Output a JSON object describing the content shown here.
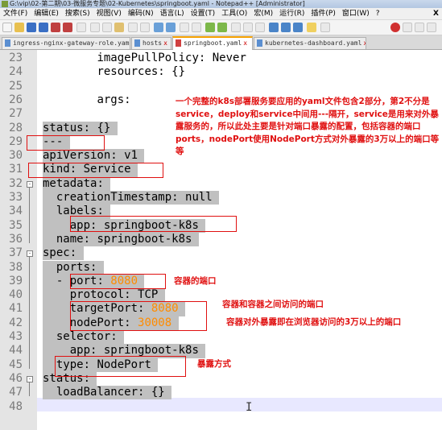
{
  "window": {
    "title": "G:\\vip\\02-第二期\\03-微服务专题\\02-Kubernetes\\springboot.yaml - Notepad++ [Administrator]"
  },
  "menu": [
    {
      "label": "文件(F)"
    },
    {
      "label": "编辑(E)"
    },
    {
      "label": "搜索(S)"
    },
    {
      "label": "视图(V)"
    },
    {
      "label": "编码(N)"
    },
    {
      "label": "语言(L)"
    },
    {
      "label": "设置(T)"
    },
    {
      "label": "工具(O)"
    },
    {
      "label": "宏(M)"
    },
    {
      "label": "运行(R)"
    },
    {
      "label": "插件(P)"
    },
    {
      "label": "窗口(W)"
    },
    {
      "label": "?"
    }
  ],
  "menu_close": "X",
  "tabs": [
    {
      "label": "ingress-nginx-gateway-role.yaml",
      "active": false
    },
    {
      "label": "hosts",
      "active": false
    },
    {
      "label": "springboot.yaml",
      "active": true
    },
    {
      "label": "kubernetes-dashboard.yaml",
      "active": false
    }
  ],
  "tab_close": "x",
  "editor": {
    "lines": [
      {
        "num": "23",
        "indent": "        ",
        "key": "imagePullPolicy",
        "val": " Never",
        "valType": "v"
      },
      {
        "num": "24",
        "indent": "        ",
        "key": "resources",
        "val": " {}",
        "valType": "v"
      },
      {
        "num": "25",
        "indent": "",
        "key": "",
        "val": "",
        "valType": "v"
      },
      {
        "num": "26",
        "indent": "        ",
        "key": "args",
        "val": "",
        "valType": "v"
      },
      {
        "num": "27",
        "indent": "",
        "key": "",
        "val": "",
        "valType": "v"
      },
      {
        "num": "28",
        "indent": "",
        "key": "status",
        "val": " {}",
        "valType": "v"
      },
      {
        "num": "29",
        "indent": "",
        "key": "",
        "val": "---",
        "valType": "v",
        "raw": true
      },
      {
        "num": "30",
        "indent": "",
        "key": "apiVersion",
        "val": " v1",
        "valType": "v"
      },
      {
        "num": "31",
        "indent": "",
        "key": "kind",
        "val": " Service",
        "valType": "v"
      },
      {
        "num": "32",
        "indent": "",
        "key": "metadata",
        "val": "",
        "valType": "v"
      },
      {
        "num": "33",
        "indent": "  ",
        "key": "creationTimestamp",
        "val": " null",
        "valType": "v"
      },
      {
        "num": "34",
        "indent": "  ",
        "key": "labels",
        "val": "",
        "valType": "v"
      },
      {
        "num": "35",
        "indent": "    ",
        "key": "app",
        "val": " springboot-k8s",
        "valType": "v"
      },
      {
        "num": "36",
        "indent": "  ",
        "key": "name",
        "val": " springboot-k8s",
        "valType": "v"
      },
      {
        "num": "37",
        "indent": "",
        "key": "spec",
        "val": "",
        "valType": "v"
      },
      {
        "num": "38",
        "indent": "  ",
        "key": "ports",
        "val": "",
        "valType": "v"
      },
      {
        "num": "39",
        "indent": "  - ",
        "key": "port",
        "val": " 8080",
        "valType": "n"
      },
      {
        "num": "40",
        "indent": "    ",
        "key": "protocol",
        "val": " TCP",
        "valType": "v"
      },
      {
        "num": "41",
        "indent": "    ",
        "key": "targetPort",
        "val": " 8080",
        "valType": "n"
      },
      {
        "num": "42",
        "indent": "    ",
        "key": "nodePort",
        "val": " 30008",
        "valType": "n"
      },
      {
        "num": "43",
        "indent": "  ",
        "key": "selector",
        "val": "",
        "valType": "v"
      },
      {
        "num": "44",
        "indent": "    ",
        "key": "app",
        "val": " springboot-k8s",
        "valType": "v"
      },
      {
        "num": "45",
        "indent": "  ",
        "key": "type",
        "val": " NodePort",
        "valType": "v"
      },
      {
        "num": "46",
        "indent": "",
        "key": "status",
        "val": "",
        "valType": "v"
      },
      {
        "num": "47",
        "indent": "  ",
        "key": "loadBalancer",
        "val": " {}",
        "valType": "v"
      },
      {
        "num": "48",
        "indent": "",
        "key": "",
        "val": "",
        "valType": "v"
      }
    ]
  },
  "annotations": {
    "main": "一个完整的k8s部署服务要应用的yaml文件包含2部分，第2不分是service，deploy和service中间用---隔开，service是用来对外暴露服务的，所以此处主要是针对端口暴露的配置，包括容器的端口ports，nodePort使用NodePort方式对外暴露的3万以上的端口等等",
    "port": "容器的端口",
    "targetPort": "容器和容器之间访问的端口",
    "nodePort": "容器对外暴露即在浏览器访问的3万以上的端口",
    "type": "暴露方式"
  },
  "colors": {
    "annotation": "#e01010",
    "number": "#ff8c00",
    "selection": "#c0c0c0",
    "tab_active_accent": "#f5a000"
  }
}
